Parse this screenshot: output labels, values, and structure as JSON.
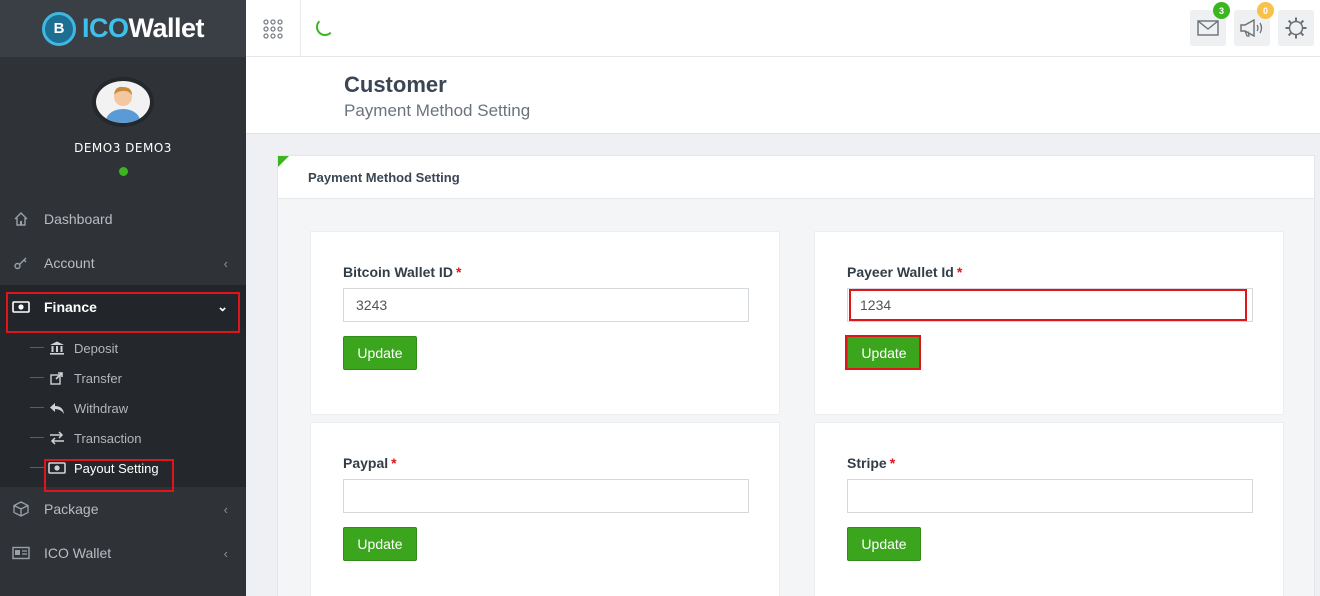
{
  "app": {
    "logo_part1": "ICO",
    "logo_part2": "Wallet",
    "logo_coin_symbol": "B"
  },
  "profile": {
    "name": "DEMO3 DEMO3",
    "status": "online"
  },
  "sidebar": {
    "items": [
      {
        "label": "Dashboard",
        "icon": "home-icon",
        "has_chevron": false
      },
      {
        "label": "Account",
        "icon": "key-icon",
        "has_chevron": true
      },
      {
        "label": "Finance",
        "icon": "money-icon",
        "has_chevron": true,
        "active": true
      },
      {
        "label": "Package",
        "icon": "cube-icon",
        "has_chevron": true
      },
      {
        "label": "ICO Wallet",
        "icon": "id-card-icon",
        "has_chevron": true
      }
    ],
    "finance_submenu": [
      {
        "label": "Deposit",
        "icon": "bank-icon"
      },
      {
        "label": "Transfer",
        "icon": "share-icon"
      },
      {
        "label": "Withdraw",
        "icon": "reply-icon"
      },
      {
        "label": "Transaction",
        "icon": "exchange-icon"
      },
      {
        "label": "Payout Setting",
        "icon": "money-icon",
        "current": true
      }
    ]
  },
  "topbar": {
    "mail_count": "3",
    "announcement_count": "0"
  },
  "header": {
    "title": "Customer",
    "subtitle": "Payment Method Setting"
  },
  "card": {
    "title": "Payment Method Setting"
  },
  "payment_methods": {
    "bitcoin": {
      "label": "Bitcoin Wallet ID",
      "required": "*",
      "value": "3243",
      "button": "Update"
    },
    "payeer": {
      "label": "Payeer Wallet Id",
      "required": "*",
      "value": "1234",
      "button": "Update"
    },
    "paypal": {
      "label": "Paypal",
      "required": "*",
      "value": "",
      "button": "Update"
    },
    "stripe": {
      "label": "Stripe",
      "required": "*",
      "value": "",
      "button": "Update"
    }
  },
  "colors": {
    "accent_green": "#3ca51e",
    "highlight_red": "#e0141b",
    "sidebar_bg": "#2f3338",
    "logo_blue": "#3fc0ea"
  }
}
